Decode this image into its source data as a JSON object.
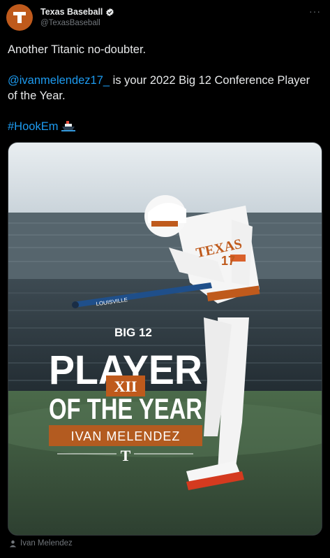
{
  "account": {
    "name": "Texas Baseball",
    "handle": "@TexasBaseball",
    "avatar_icon": "longhorn-t-logo",
    "brand_color": "#bf5a1c"
  },
  "tweet": {
    "line1": "Another Titanic no-doubter.",
    "mention": "@ivanmelendez17_",
    "line2_rest": " is your 2022 Big 12 Conference Player of the Year.",
    "hashtag": "#HookEm",
    "hashtag_emoji": "ship-emoji"
  },
  "media": {
    "graphic_top": "BIG 12",
    "graphic_title_1": "PLAYER",
    "graphic_title_2": "OF THE YEAR",
    "graphic_logo": "XII",
    "graphic_name": "IVAN MELENDEZ",
    "graphic_footer": "T",
    "jersey_text": "TEXAS",
    "jersey_number": "17",
    "bat_text": "LOUISVILLE"
  },
  "tag": {
    "icon": "person-icon",
    "label": "Ivan Melendez"
  },
  "colors": {
    "link": "#1d9bf0",
    "secondary": "#71767b",
    "text": "#e7e9ea"
  }
}
